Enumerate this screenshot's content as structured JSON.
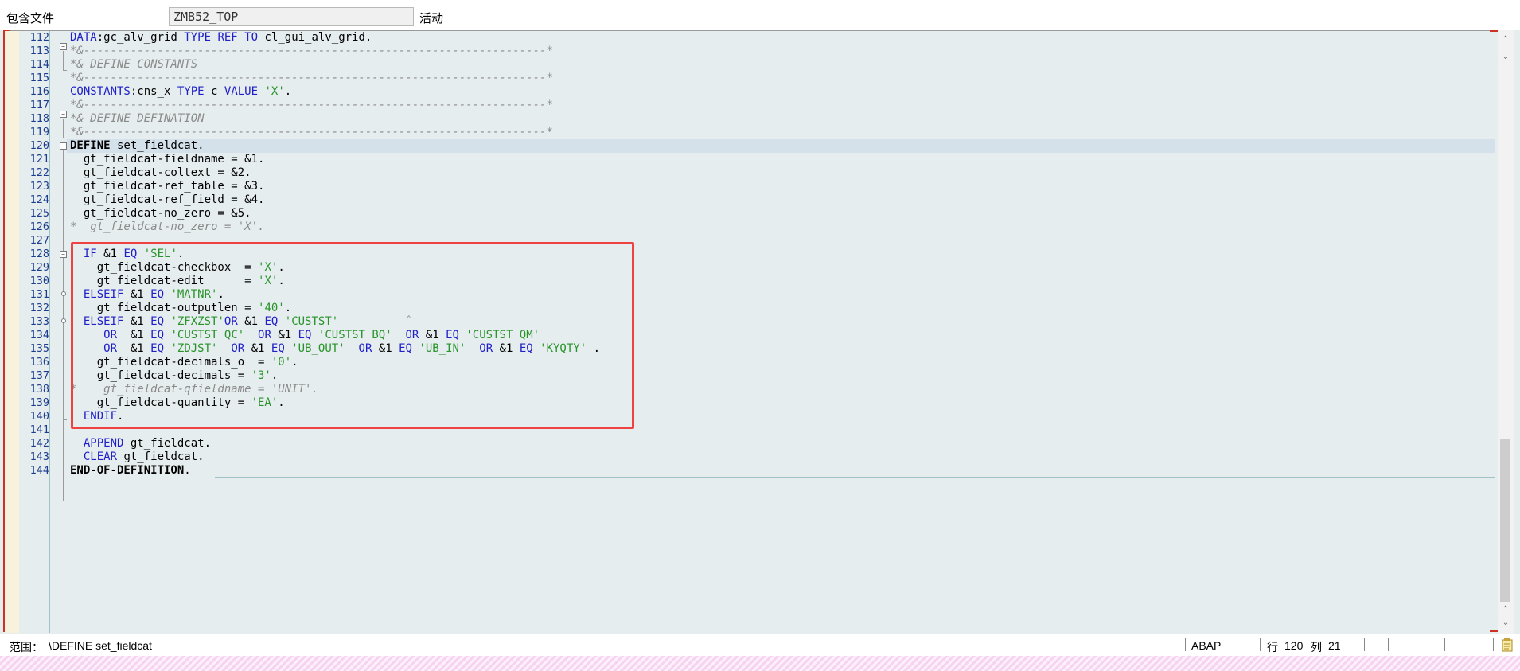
{
  "include": {
    "label": "包含文件",
    "program": "ZMB52_TOP",
    "status": "活动"
  },
  "editor": {
    "line_numbers": [
      "112",
      "113",
      "114",
      "115",
      "116",
      "117",
      "118",
      "119",
      "120",
      "121",
      "122",
      "123",
      "124",
      "125",
      "126",
      "127",
      "128",
      "129",
      "130",
      "131",
      "132",
      "133",
      "134",
      "135",
      "136",
      "137",
      "138",
      "139",
      "140",
      "141",
      "142",
      "143",
      "144"
    ],
    "l112": {
      "a": "DATA",
      "b": ":gc_alv_grid ",
      "c": "TYPE",
      "d": " ",
      "e": "REF",
      "f": " ",
      "g": "TO",
      "h": " cl_gui_alv_grid."
    },
    "l113": "*&---------------------------------------------------------------------*",
    "l114": "*& DEFINE CONSTANTS",
    "l115": "*&---------------------------------------------------------------------*",
    "l116": {
      "a": "CONSTANTS",
      "b": ":cns_x ",
      "c": "TYPE",
      "d": " c ",
      "e": "VALUE",
      "f": " ",
      "g": "'X'",
      "h": "."
    },
    "l117": "*&---------------------------------------------------------------------*",
    "l118": "*& DEFINE DEFINATION",
    "l119": "*&---------------------------------------------------------------------*",
    "l120": {
      "a": "DEFINE",
      "b": " set_fieldcat."
    },
    "l121": "  gt_fieldcat-fieldname = &1.",
    "l122": "  gt_fieldcat-coltext = &2.",
    "l123": "  gt_fieldcat-ref_table = &3.",
    "l124": "  gt_fieldcat-ref_field = &4.",
    "l125": "  gt_fieldcat-no_zero = &5.",
    "l126": "*  gt_fieldcat-no_zero = 'X'.",
    "l128": {
      "a": "  ",
      "b": "IF",
      "c": " &1 ",
      "d": "EQ",
      "e": " ",
      "f": "'SEL'",
      "g": "."
    },
    "l129": {
      "a": "    gt_fieldcat-checkbox  = ",
      "b": "'X'",
      "c": "."
    },
    "l130": {
      "a": "    gt_fieldcat-edit      = ",
      "b": "'X'",
      "c": "."
    },
    "l131": {
      "a": "  ",
      "b": "ELSEIF",
      "c": " &1 ",
      "d": "EQ",
      "e": " ",
      "f": "'MATNR'",
      "g": "."
    },
    "l132": {
      "a": "    gt_fieldcat-outputlen = ",
      "b": "'40'",
      "c": "."
    },
    "l133": {
      "a": "  ",
      "b": "ELSEIF",
      "c": " &1 ",
      "d": "EQ",
      "e": " ",
      "f": "'ZFXZST'",
      "g": "OR",
      "h": " &1 ",
      "i": "EQ",
      "j": " ",
      "k": "'CUSTST'",
      "l": "          ˆ"
    },
    "l134": {
      "a": "     ",
      "b": "OR",
      "c": "  &1 ",
      "d": "EQ",
      "e": " ",
      "f": "'CUSTST_QC'",
      "g": "  ",
      "h": "OR",
      "i": " &1 ",
      "j": "EQ",
      "k": " ",
      "l": "'CUSTST_BQ'",
      "m": "  ",
      "n": "OR",
      "o": " &1 ",
      "p": "EQ",
      "q": " ",
      "r": "'CUSTST_QM'"
    },
    "l135": {
      "a": "     ",
      "b": "OR",
      "c": "  &1 ",
      "d": "EQ",
      "e": " ",
      "f": "'ZDJST'",
      "g": "  ",
      "h": "OR",
      "i": " &1 ",
      "j": "EQ",
      "k": " ",
      "l": "'UB_OUT'",
      "m": "  ",
      "n": "OR",
      "o": " &1 ",
      "p": "EQ",
      "q": " ",
      "r": "'UB_IN'",
      "s": "  ",
      "t": "OR",
      "u": " &1 ",
      "v": "EQ",
      "w": " ",
      "x": "'KYQTY'",
      "y": " ."
    },
    "l136": {
      "a": "    gt_fieldcat-decimals_o  = ",
      "b": "'0'",
      "c": "."
    },
    "l137": {
      "a": "    gt_fieldcat-decimals = ",
      "b": "'3'",
      "c": "."
    },
    "l138": "*    gt_fieldcat-qfieldname = 'UNIT'.",
    "l139": {
      "a": "    gt_fieldcat-quantity = ",
      "b": "'EA'",
      "c": "."
    },
    "l140": {
      "a": "  ",
      "b": "ENDIF",
      "c": "."
    },
    "l142": {
      "a": "  ",
      "b": "APPEND",
      "c": " gt_fieldcat."
    },
    "l143": {
      "a": "  ",
      "b": "CLEAR",
      "c": " gt_fieldcat."
    },
    "l144": {
      "a": "END-OF-DEFINITION",
      "b": "."
    }
  },
  "statusbar": {
    "scope_label": "范围：",
    "scope_value": "\\DEFINE set_fieldcat",
    "language": "ABAP",
    "row_label": "行",
    "row_value": "120",
    "col_label": "列",
    "col_value": "21"
  },
  "icons": {
    "scroll_up": "scroll-up-arrow",
    "scroll_down": "scroll-down-arrow",
    "notes": "notes-icon"
  },
  "colors": {
    "keyword": "#2020c8",
    "string": "#28942a",
    "comment": "#8a8a8a",
    "highlight_box": "#ef4242",
    "line_number": "#1c3d8f"
  }
}
